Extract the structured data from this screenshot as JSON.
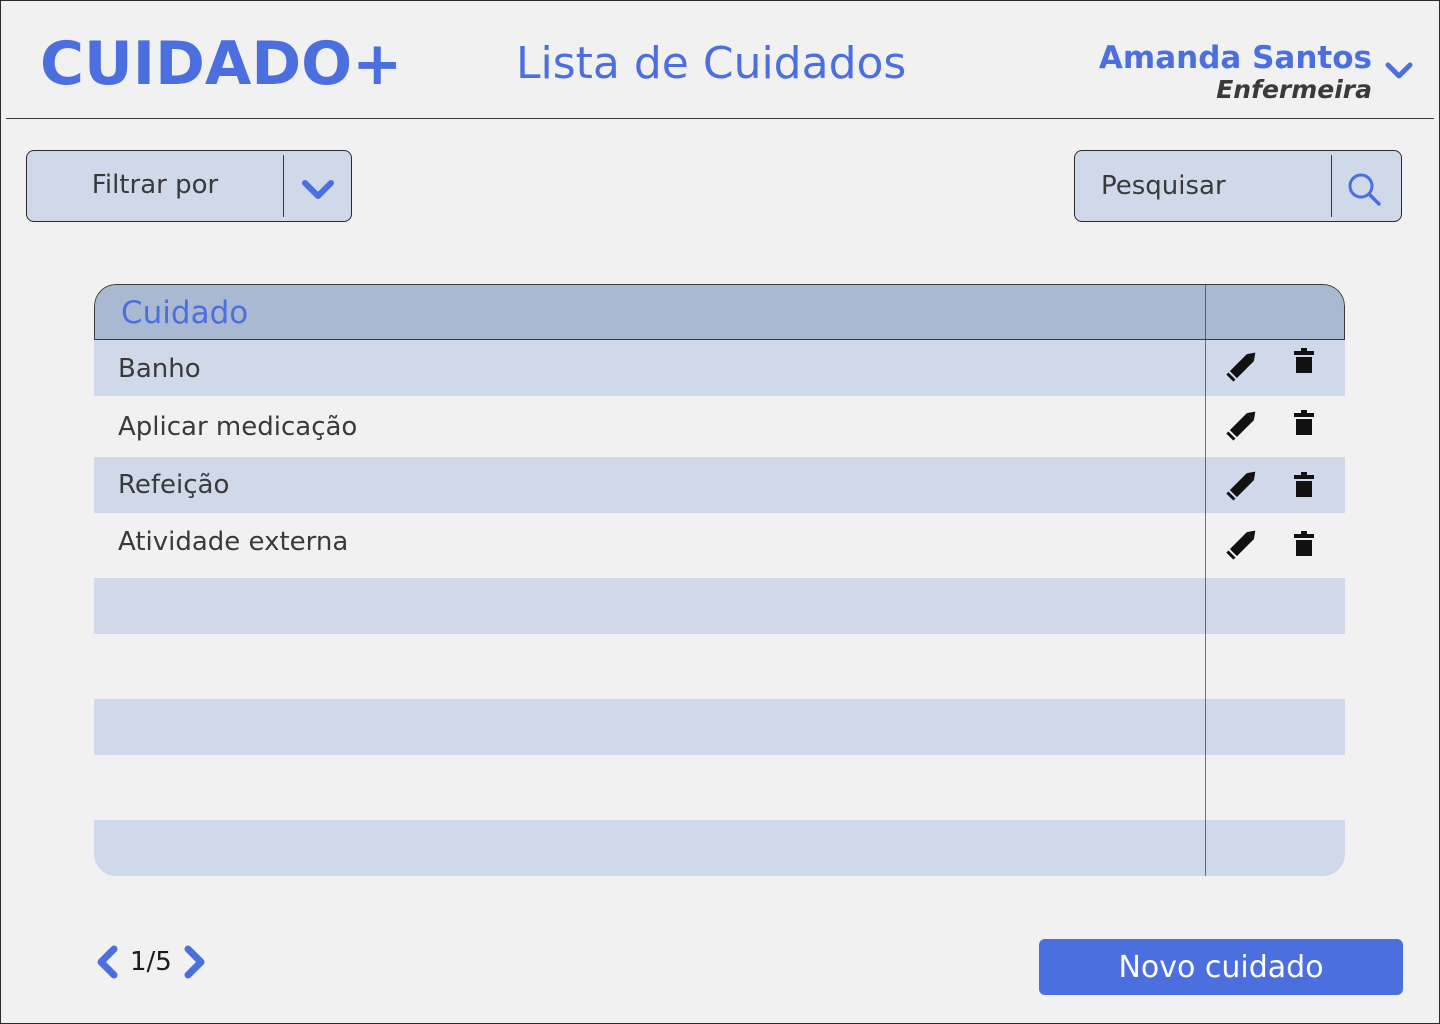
{
  "header": {
    "logo": "CUIDADO+",
    "title": "Lista de Cuidados",
    "user_name": "Amanda Santos",
    "user_role": "Enfermeira",
    "user_menu_icon": "chevron-down-icon"
  },
  "filter": {
    "label": "Filtrar por",
    "icon": "chevron-down-icon"
  },
  "search": {
    "placeholder": "Pesquisar",
    "icon": "search-icon"
  },
  "table": {
    "column_header": "Cuidado",
    "rows": [
      {
        "label": "Banho"
      },
      {
        "label": "Aplicar medicação"
      },
      {
        "label": "Refeição"
      },
      {
        "label": "Atividade externa"
      },
      {
        "label": ""
      },
      {
        "label": ""
      },
      {
        "label": ""
      },
      {
        "label": ""
      },
      {
        "label": ""
      }
    ],
    "row_actions": [
      "pencil-icon",
      "trash-icon"
    ]
  },
  "pagination": {
    "current": "1/5",
    "prev_icon": "chevron-left-icon",
    "next_icon": "chevron-right-icon"
  },
  "actions": {
    "new_label": "Novo cuidado"
  },
  "colors": {
    "accent": "#4c6fe0",
    "row_shade": "#cfd9ea",
    "header_bg": "#aab9d2",
    "background": "#f1f1f2"
  }
}
